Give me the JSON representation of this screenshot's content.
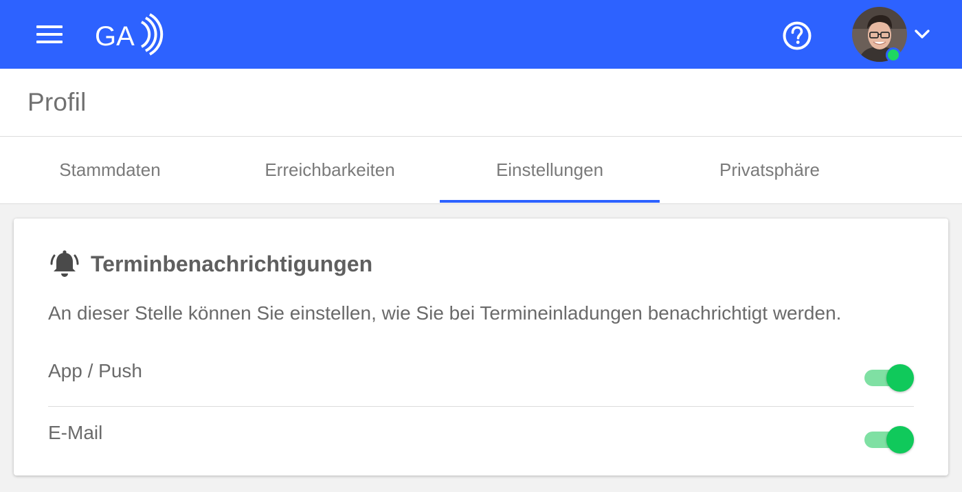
{
  "appbar": {
    "logo_text": "GA",
    "menu_icon": "hamburger-menu-icon",
    "help_icon": "help-circle-icon",
    "chevron_icon": "chevron-down-icon",
    "status_color": "#1ed760",
    "brand_color": "#2d62ff"
  },
  "page": {
    "title": "Profil"
  },
  "tabs": [
    {
      "label": "Stammdaten",
      "active": false
    },
    {
      "label": "Erreichbarkeiten",
      "active": false
    },
    {
      "label": "Einstellungen",
      "active": true
    },
    {
      "label": "Privatsphäre",
      "active": false
    }
  ],
  "card": {
    "icon": "bell-icon",
    "title": "Terminbenachrichtigungen",
    "description": "An dieser Stelle können Sie einstellen, wie Sie bei Termineinladungen benachrichtigt werden.",
    "settings": [
      {
        "label": "App / Push",
        "enabled": true
      },
      {
        "label": "E-Mail",
        "enabled": true
      }
    ],
    "toggle_on_color": "#10c95b"
  }
}
